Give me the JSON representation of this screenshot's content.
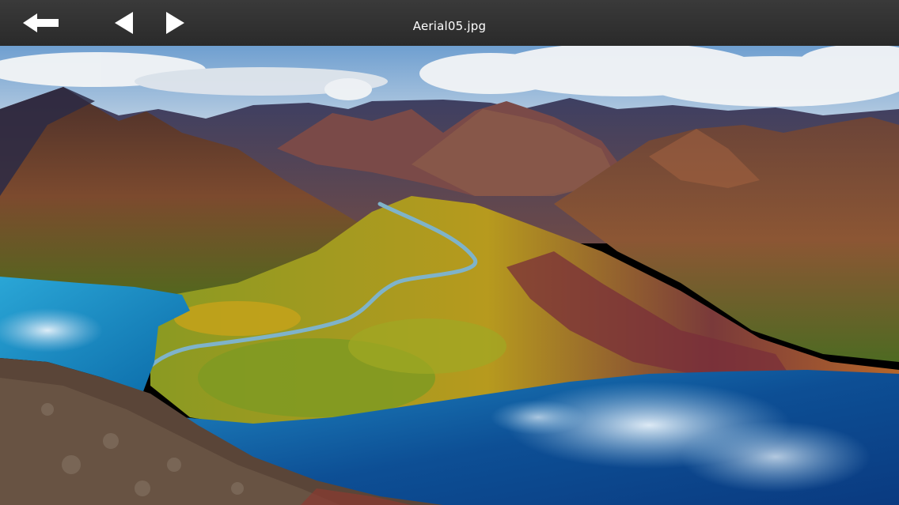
{
  "toolbar": {
    "title": "Aerial05.jpg",
    "background": "#2e2e2e",
    "icons": {
      "back": "arrow-left-icon",
      "previous": "triangle-left-icon",
      "next": "triangle-right-icon"
    }
  },
  "photo": {
    "subject": "aerial-landscape-image"
  }
}
